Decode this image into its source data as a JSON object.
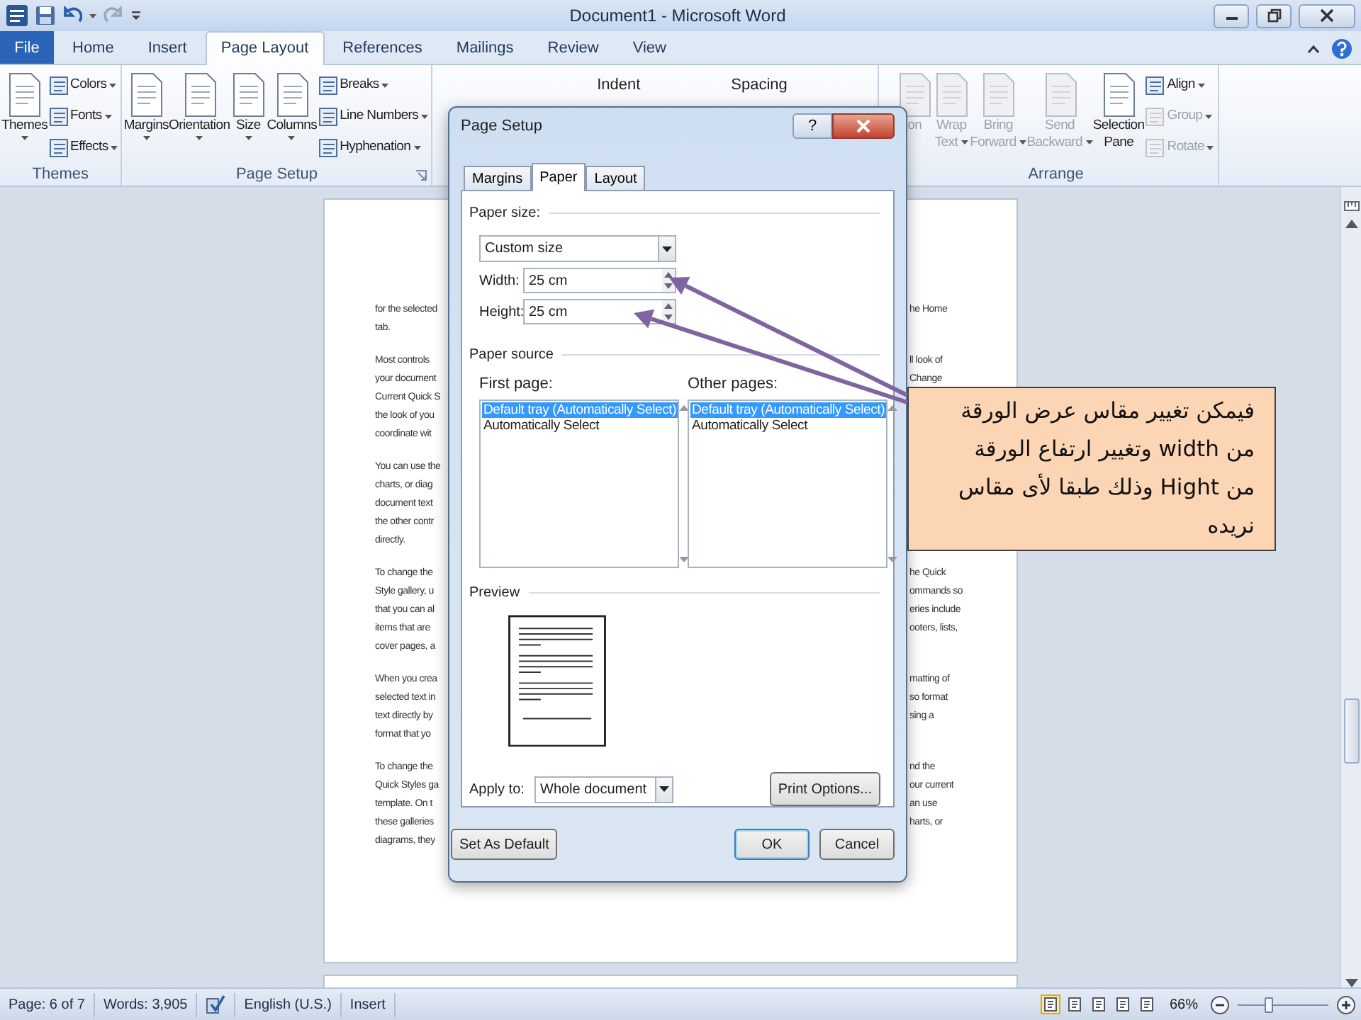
{
  "window": {
    "title": "Document1 - Microsoft Word"
  },
  "ribbon": {
    "tabs": [
      {
        "label": "File",
        "kind": "file",
        "selected": false
      },
      {
        "label": "Home",
        "kind": "tab",
        "selected": false
      },
      {
        "label": "Insert",
        "kind": "tab",
        "selected": false
      },
      {
        "label": "Page Layout",
        "kind": "tab",
        "selected": true
      },
      {
        "label": "References",
        "kind": "tab",
        "selected": false
      },
      {
        "label": "Mailings",
        "kind": "tab",
        "selected": false
      },
      {
        "label": "Review",
        "kind": "tab",
        "selected": false
      },
      {
        "label": "View",
        "kind": "tab",
        "selected": false
      }
    ],
    "groups": [
      {
        "kind": "buttons",
        "label": "Themes",
        "launcher": false,
        "large": [
          {
            "label": "Themes",
            "dropdown": true,
            "disabled": false
          }
        ],
        "small": [
          {
            "label": "Colors",
            "dropdown": true,
            "disabled": false
          },
          {
            "label": "Fonts",
            "dropdown": true,
            "disabled": false
          },
          {
            "label": "Effects",
            "dropdown": true,
            "disabled": false
          }
        ]
      },
      {
        "kind": "buttons",
        "label": "Page Setup",
        "launcher": true,
        "large": [
          {
            "label": "Margins",
            "dropdown": true,
            "disabled": false
          },
          {
            "label": "Orientation",
            "dropdown": true,
            "disabled": false
          },
          {
            "label": "Size",
            "dropdown": true,
            "disabled": false
          },
          {
            "label": "Columns",
            "dropdown": true,
            "disabled": false
          }
        ],
        "small": [
          {
            "label": "Breaks",
            "dropdown": true,
            "disabled": false
          },
          {
            "label": "Line Numbers",
            "dropdown": true,
            "disabled": false
          },
          {
            "label": "Hyphenation",
            "dropdown": true,
            "disabled": false
          }
        ]
      },
      {
        "kind": "headings",
        "headings": [
          "Indent",
          "Spacing"
        ]
      },
      {
        "kind": "buttons",
        "label": "Arrange",
        "launcher": false,
        "large": [
          {
            "label": "on",
            "dropdown": false,
            "disabled": true
          },
          {
            "label": "Wrap Text",
            "dropdown": true,
            "disabled": true
          },
          {
            "label": "Bring Forward",
            "dropdown": true,
            "disabled": true
          },
          {
            "label": "Send Backward",
            "dropdown": true,
            "disabled": true
          },
          {
            "label": "Selection Pane",
            "dropdown": false,
            "disabled": false
          }
        ],
        "small": [
          {
            "label": "Align",
            "dropdown": true,
            "disabled": false
          },
          {
            "label": "Group",
            "dropdown": true,
            "disabled": true
          },
          {
            "label": "Rotate",
            "dropdown": true,
            "disabled": true
          }
        ]
      }
    ]
  },
  "document": {
    "paragraphs": [
      {
        "lines": [
          {
            "left": "for the selected",
            "right": "he Home"
          },
          {
            "left": "tab."
          }
        ]
      },
      {
        "lines": [
          {
            "left": "Most controls",
            "right": "ll look of"
          },
          {
            "left": "your document",
            "right": "Change"
          },
          {
            "left": "Current Quick S"
          },
          {
            "left": "the look of you"
          },
          {
            "left": "coordinate wit"
          }
        ]
      },
      {
        "lines": [
          {
            "left": "You can use the"
          },
          {
            "left": "charts, or diag"
          },
          {
            "left": "document text"
          },
          {
            "left": "the other contr"
          },
          {
            "left": "directly."
          }
        ]
      },
      {
        "lines": [
          {
            "left": "To change the",
            "right": "he Quick"
          },
          {
            "left": "Style gallery, u",
            "right": "ommands so"
          },
          {
            "left": "that you can al",
            "right": "eries include"
          },
          {
            "left": "items that are",
            "right": "ooters, lists,"
          },
          {
            "left": "cover pages, a"
          }
        ]
      },
      {
        "lines": [
          {
            "left": "When you crea",
            "right": "matting of"
          },
          {
            "left": "selected text in",
            "right": "so format"
          },
          {
            "left": "text directly by",
            "right": "sing a"
          },
          {
            "left": "format that yo"
          }
        ]
      },
      {
        "lines": [
          {
            "left": "To change the",
            "right": "nd the"
          },
          {
            "left": "Quick Styles ga",
            "right": "our current"
          },
          {
            "left": "template. On t",
            "right": "an use"
          },
          {
            "left": "these galleries",
            "right": "harts, or"
          },
          {
            "left": "diagrams, they"
          }
        ]
      }
    ]
  },
  "dialog": {
    "title": "Page Setup",
    "help": "?",
    "tabs": [
      {
        "label": "Margins",
        "selected": false
      },
      {
        "label": "Paper",
        "selected": true
      },
      {
        "label": "Layout",
        "selected": false
      }
    ],
    "paper_size": {
      "heading": "Paper size:",
      "value": "Custom size",
      "width_label": "Width:",
      "width": "25 cm",
      "height_label": "Height:",
      "height": "25 cm"
    },
    "paper_source": {
      "heading": "Paper source",
      "lists": [
        {
          "label": "First page:",
          "items": [
            {
              "text": "Default tray (Automatically Select)",
              "selected": true
            },
            {
              "text": "Automatically Select",
              "selected": false
            }
          ]
        },
        {
          "label": "Other pages:",
          "items": [
            {
              "text": "Default tray (Automatically Select)",
              "selected": true
            },
            {
              "text": "Automatically Select",
              "selected": false
            }
          ]
        }
      ]
    },
    "preview": {
      "heading": "Preview"
    },
    "apply_to": {
      "label": "Apply to:",
      "value": "Whole document"
    },
    "print_options": "Print Options...",
    "buttons": [
      {
        "label": "Set As Default",
        "default": false
      },
      {
        "label": "OK",
        "default": true
      },
      {
        "label": "Cancel",
        "default": false
      }
    ]
  },
  "callout": {
    "text": "فيمكن تغيير مقاس عرض الورقة من width وتغيير ارتفاع الورقة من Hight وذلك طبقا لأى مقاس نريده"
  },
  "status_bar": {
    "items": [
      {
        "kind": "text",
        "text": "Page: 6 of 7"
      },
      {
        "kind": "text",
        "text": "Words: 3,905"
      },
      {
        "kind": "icon"
      },
      {
        "kind": "text",
        "text": "English (U.S.)"
      },
      {
        "kind": "text",
        "text": "Insert"
      }
    ],
    "views": [
      {
        "selected": true
      },
      {
        "selected": false
      },
      {
        "selected": false
      },
      {
        "selected": false
      },
      {
        "selected": false
      }
    ],
    "zoom": "66%",
    "zoom_slider": {
      "level": 0.35
    }
  }
}
